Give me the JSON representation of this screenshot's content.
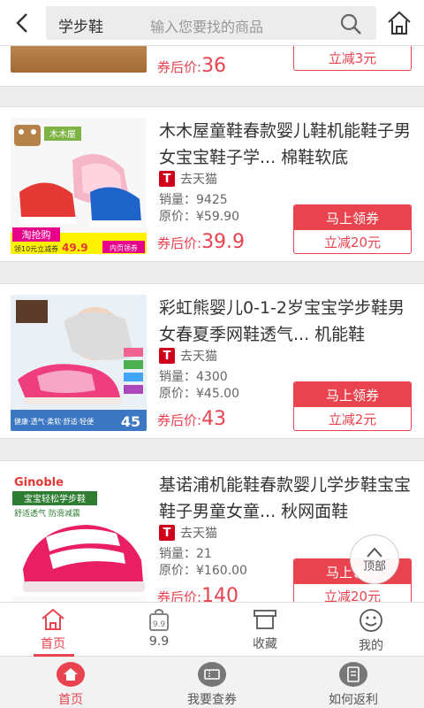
{
  "header": {
    "keyword": "学步鞋",
    "placeholder": "输入您要找的商品"
  },
  "labels": {
    "after_coupon": "券后价:",
    "get_coupon": "马上领券",
    "to_top": "顶部",
    "sales_prefix": "销量：",
    "orig_prefix": "原价：¥"
  },
  "partial_item": {
    "after_price": "36",
    "coupon": "立减3元"
  },
  "items": [
    {
      "title": "木木屋童鞋春款婴儿鞋机能鞋子男女宝宝鞋子学... 棉鞋软底",
      "shop": "去天猫",
      "sales": "9425",
      "original_price": "59.90",
      "after_price": "39.9",
      "coupon": "立减20元",
      "thumb_text": {
        "brand": "木木屋",
        "promo": "淘抢购",
        "price": "49.9",
        "sub": "领10元立减券",
        "sub2": "内页领券"
      }
    },
    {
      "title": "彩虹熊婴儿0-1-2岁宝宝学步鞋男女春夏季网鞋透气... 机能鞋",
      "shop": "去天猫",
      "sales": "4300",
      "original_price": "45.00",
      "after_price": "43",
      "coupon": "立减2元",
      "thumb_text": {
        "footer": "健康·透气·柔软·舒适·轻便",
        "price": "45"
      }
    },
    {
      "title": "基诺浦机能鞋春款婴儿学步鞋宝宝鞋子男童女童... 秋网面鞋",
      "shop": "去天猫",
      "sales": "21",
      "original_price": "160.00",
      "after_price": "140",
      "coupon": "立减20元",
      "thumb_text": {
        "brand": "Ginoble",
        "line1": "宝宝轻松学步鞋",
        "line2": "舒适透气 防滑减震"
      }
    }
  ],
  "tabs": [
    {
      "label": "首页",
      "icon": "home-outline-icon",
      "active": true
    },
    {
      "label": "9.9",
      "icon": "bag-99-icon",
      "active": false
    },
    {
      "label": "收藏",
      "icon": "box-icon",
      "active": false
    },
    {
      "label": "我的",
      "icon": "smiley-icon",
      "active": false
    }
  ],
  "bottom_nav": [
    {
      "label": "首页",
      "icon": "home-filled-icon",
      "active": true
    },
    {
      "label": "我要查券",
      "icon": "ticket-icon",
      "active": false
    },
    {
      "label": "如何返利",
      "icon": "list-doc-icon",
      "active": false
    }
  ],
  "colors": {
    "accent": "#e8434e",
    "tmall": "#d0021b",
    "bg": "#ececec"
  }
}
